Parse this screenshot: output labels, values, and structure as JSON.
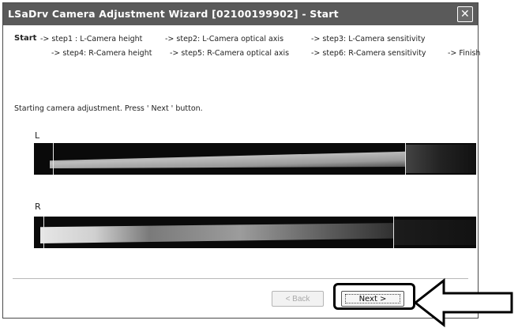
{
  "window": {
    "title": "LSaDrv Camera Adjustment Wizard [02100199902] - Start",
    "close_glyph": "✕"
  },
  "steps": {
    "row1": {
      "start": "Start",
      "step1": "-> step1 : L-Camera height",
      "step2": "-> step2: L-Camera optical axis",
      "step3": "-> step3: L-Camera sensitivity"
    },
    "row2": {
      "step4": "-> step4: R-Camera height",
      "step5": "-> step5: R-Camera optical axis",
      "step6": "-> step6: R-Camera sensitivity",
      "finish": "-> Finish"
    }
  },
  "status_text": "Starting camera adjustment. Press ' Next ' button.",
  "cameras": {
    "left": {
      "label": "L"
    },
    "right": {
      "label": "R"
    }
  },
  "buttons": {
    "back": "< Back",
    "next": "Next >"
  },
  "icons": {
    "close": "close-icon",
    "callout": "callout-arrow-icon"
  },
  "colors": {
    "titlebar": "#5a5a5a",
    "strip_background": "#0a0a0a",
    "highlight": "#000000"
  }
}
